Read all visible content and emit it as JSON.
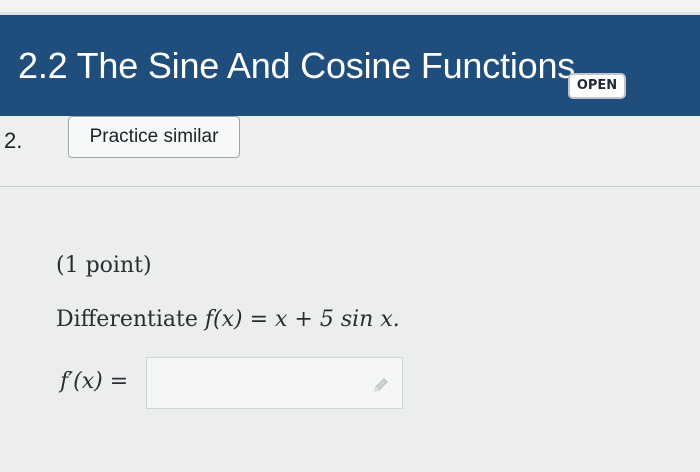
{
  "header": {
    "title": "2.2 The Sine And Cosine Functions",
    "badge": "OPEN",
    "color": "#1f4e7d"
  },
  "question": {
    "number": "2.",
    "practice_label": "Practice similar"
  },
  "problem": {
    "points": "(1 point)",
    "prompt_prefix": "Differentiate ",
    "expression": "f(x) = x + 5 sin x.",
    "answer_label": "f′(x) =",
    "answer_value": "",
    "answer_icon": "pencil-icon"
  }
}
